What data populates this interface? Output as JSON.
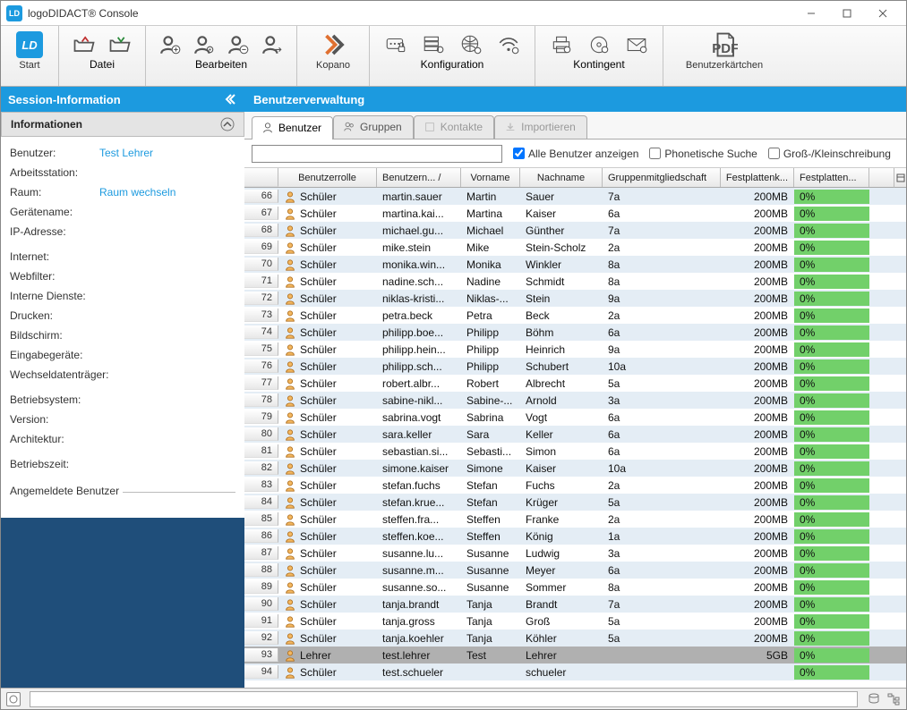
{
  "window": {
    "title": "logoDIDACT® Console",
    "logo_text": "LD"
  },
  "toolbar": {
    "start": "Start",
    "datei": "Datei",
    "bearbeiten": "Bearbeiten",
    "kopano": "Kopano",
    "konfiguration": "Konfiguration",
    "kontingent": "Kontingent",
    "benutzerkaertchen": "Benutzerkärtchen"
  },
  "sidebar": {
    "session_info": "Session-Information",
    "informationen": "Informationen",
    "rows": {
      "benutzer_k": "Benutzer:",
      "benutzer_v": "Test Lehrer",
      "arbeitsstation_k": "Arbeitsstation:",
      "raum_k": "Raum:",
      "raum_v": "Raum wechseln",
      "geraetename_k": "Gerätename:",
      "ip_k": "IP-Adresse:",
      "internet_k": "Internet:",
      "webfilter_k": "Webfilter:",
      "dienste_k": "Interne Dienste:",
      "drucken_k": "Drucken:",
      "bildschirm_k": "Bildschirm:",
      "eingabe_k": "Eingabegeräte:",
      "wechsel_k": "Wechseldatenträger:",
      "os_k": "Betriebsystem:",
      "version_k": "Version:",
      "arch_k": "Architektur:",
      "uptime_k": "Betriebszeit:",
      "logged_k": "Angemeldete Benutzer"
    }
  },
  "content": {
    "heading": "Benutzerverwaltung",
    "tabs": {
      "benutzer": "Benutzer",
      "gruppen": "Gruppen",
      "kontakte": "Kontakte",
      "importieren": "Importieren"
    },
    "filter": {
      "alle": "Alle Benutzer anzeigen",
      "phon": "Phonetische Suche",
      "case": "Groß-/Kleinschreibung"
    },
    "columns": {
      "idx": "",
      "role": "Benutzerrolle",
      "user": "Benutzern... /",
      "vor": "Vorname",
      "nach": "Nachname",
      "grp": "Gruppenmitgliedschaft",
      "quota": "Festplattenk...",
      "pct": "Festplatten..."
    },
    "rows": [
      {
        "n": "66",
        "role": "Schüler",
        "user": "martin.sauer",
        "vor": "Martin",
        "nach": "Sauer",
        "grp": "7a",
        "quota": "200MB",
        "pct": "0%"
      },
      {
        "n": "67",
        "role": "Schüler",
        "user": "martina.kai...",
        "vor": "Martina",
        "nach": "Kaiser",
        "grp": "6a",
        "quota": "200MB",
        "pct": "0%"
      },
      {
        "n": "68",
        "role": "Schüler",
        "user": "michael.gu...",
        "vor": "Michael",
        "nach": "Günther",
        "grp": "7a",
        "quota": "200MB",
        "pct": "0%"
      },
      {
        "n": "69",
        "role": "Schüler",
        "user": "mike.stein",
        "vor": "Mike",
        "nach": "Stein-Scholz",
        "grp": "2a",
        "quota": "200MB",
        "pct": "0%"
      },
      {
        "n": "70",
        "role": "Schüler",
        "user": "monika.win...",
        "vor": "Monika",
        "nach": "Winkler",
        "grp": "8a",
        "quota": "200MB",
        "pct": "0%"
      },
      {
        "n": "71",
        "role": "Schüler",
        "user": "nadine.sch...",
        "vor": "Nadine",
        "nach": "Schmidt",
        "grp": "8a",
        "quota": "200MB",
        "pct": "0%"
      },
      {
        "n": "72",
        "role": "Schüler",
        "user": "niklas-kristi...",
        "vor": "Niklas-...",
        "nach": "Stein",
        "grp": "9a",
        "quota": "200MB",
        "pct": "0%"
      },
      {
        "n": "73",
        "role": "Schüler",
        "user": "petra.beck",
        "vor": "Petra",
        "nach": "Beck",
        "grp": "2a",
        "quota": "200MB",
        "pct": "0%"
      },
      {
        "n": "74",
        "role": "Schüler",
        "user": "philipp.boe...",
        "vor": "Philipp",
        "nach": "Böhm",
        "grp": "6a",
        "quota": "200MB",
        "pct": "0%"
      },
      {
        "n": "75",
        "role": "Schüler",
        "user": "philipp.hein...",
        "vor": "Philipp",
        "nach": "Heinrich",
        "grp": "9a",
        "quota": "200MB",
        "pct": "0%"
      },
      {
        "n": "76",
        "role": "Schüler",
        "user": "philipp.sch...",
        "vor": "Philipp",
        "nach": "Schubert",
        "grp": "10a",
        "quota": "200MB",
        "pct": "0%"
      },
      {
        "n": "77",
        "role": "Schüler",
        "user": "robert.albr...",
        "vor": "Robert",
        "nach": "Albrecht",
        "grp": "5a",
        "quota": "200MB",
        "pct": "0%"
      },
      {
        "n": "78",
        "role": "Schüler",
        "user": "sabine-nikl...",
        "vor": "Sabine-...",
        "nach": "Arnold",
        "grp": "3a",
        "quota": "200MB",
        "pct": "0%"
      },
      {
        "n": "79",
        "role": "Schüler",
        "user": "sabrina.vogt",
        "vor": "Sabrina",
        "nach": "Vogt",
        "grp": "6a",
        "quota": "200MB",
        "pct": "0%"
      },
      {
        "n": "80",
        "role": "Schüler",
        "user": "sara.keller",
        "vor": "Sara",
        "nach": "Keller",
        "grp": "6a",
        "quota": "200MB",
        "pct": "0%"
      },
      {
        "n": "81",
        "role": "Schüler",
        "user": "sebastian.si...",
        "vor": "Sebasti...",
        "nach": "Simon",
        "grp": "6a",
        "quota": "200MB",
        "pct": "0%"
      },
      {
        "n": "82",
        "role": "Schüler",
        "user": "simone.kaiser",
        "vor": "Simone",
        "nach": "Kaiser",
        "grp": "10a",
        "quota": "200MB",
        "pct": "0%"
      },
      {
        "n": "83",
        "role": "Schüler",
        "user": "stefan.fuchs",
        "vor": "Stefan",
        "nach": "Fuchs",
        "grp": "2a",
        "quota": "200MB",
        "pct": "0%"
      },
      {
        "n": "84",
        "role": "Schüler",
        "user": "stefan.krue...",
        "vor": "Stefan",
        "nach": "Krüger",
        "grp": "5a",
        "quota": "200MB",
        "pct": "0%"
      },
      {
        "n": "85",
        "role": "Schüler",
        "user": "steffen.fra...",
        "vor": "Steffen",
        "nach": "Franke",
        "grp": "2a",
        "quota": "200MB",
        "pct": "0%"
      },
      {
        "n": "86",
        "role": "Schüler",
        "user": "steffen.koe...",
        "vor": "Steffen",
        "nach": "König",
        "grp": "1a",
        "quota": "200MB",
        "pct": "0%"
      },
      {
        "n": "87",
        "role": "Schüler",
        "user": "susanne.lu...",
        "vor": "Susanne",
        "nach": "Ludwig",
        "grp": "3a",
        "quota": "200MB",
        "pct": "0%"
      },
      {
        "n": "88",
        "role": "Schüler",
        "user": "susanne.m...",
        "vor": "Susanne",
        "nach": "Meyer",
        "grp": "6a",
        "quota": "200MB",
        "pct": "0%"
      },
      {
        "n": "89",
        "role": "Schüler",
        "user": "susanne.so...",
        "vor": "Susanne",
        "nach": "Sommer",
        "grp": "8a",
        "quota": "200MB",
        "pct": "0%"
      },
      {
        "n": "90",
        "role": "Schüler",
        "user": "tanja.brandt",
        "vor": "Tanja",
        "nach": "Brandt",
        "grp": "7a",
        "quota": "200MB",
        "pct": "0%"
      },
      {
        "n": "91",
        "role": "Schüler",
        "user": "tanja.gross",
        "vor": "Tanja",
        "nach": "Groß",
        "grp": "5a",
        "quota": "200MB",
        "pct": "0%"
      },
      {
        "n": "92",
        "role": "Schüler",
        "user": "tanja.koehler",
        "vor": "Tanja",
        "nach": "Köhler",
        "grp": "5a",
        "quota": "200MB",
        "pct": "0%"
      },
      {
        "n": "93",
        "role": "Lehrer",
        "user": "test.lehrer",
        "vor": "Test",
        "nach": "Lehrer",
        "grp": "",
        "quota": "5GB",
        "pct": "0%",
        "sel": true
      },
      {
        "n": "94",
        "role": "Schüler",
        "user": "test.schueler",
        "vor": "",
        "nach": "schueler",
        "grp": "",
        "quota": "",
        "pct": "0%"
      }
    ]
  }
}
